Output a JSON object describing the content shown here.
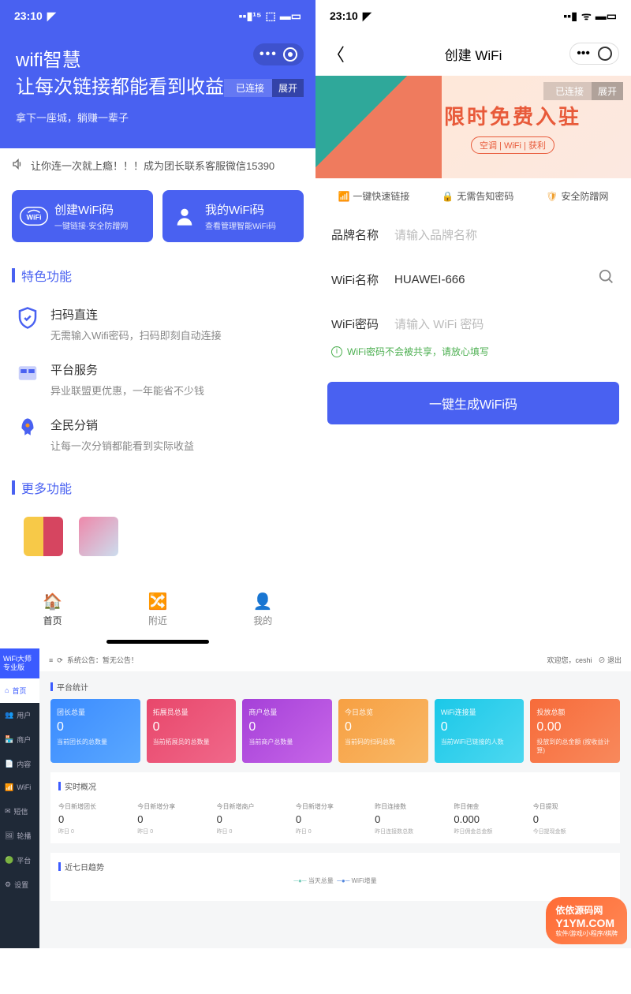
{
  "status_time": "23:10",
  "left": {
    "hero_line1": "wifi智慧",
    "hero_line2": "让每次链接都能看到收益",
    "hero_sub": "拿下一座城，躺赚一辈子",
    "conn_status": "已连接",
    "conn_expand": "展开",
    "marquee": "让你连一次就上瘾！！！成为团长联系客服微信15390",
    "card1_title": "创建WiFi码",
    "card1_sub": "一键链接·安全防蹭网",
    "card2_title": "我的WiFi码",
    "card2_sub": "查看管理智能WiFi码",
    "section1": "特色功能",
    "feat1_name": "扫码直连",
    "feat1_desc": "无需输入Wifi密码，扫码即刻自动连接",
    "feat2_name": "平台服务",
    "feat2_desc": "异业联盟更优惠，一年能省不少钱",
    "feat3_name": "全民分销",
    "feat3_desc": "让每一次分销都能看到实际收益",
    "section2": "更多功能",
    "tab_home": "首页",
    "tab_nearby": "附近",
    "tab_mine": "我的"
  },
  "right": {
    "nav_title": "创建 WiFi",
    "conn_status": "已连接",
    "conn_expand": "展开",
    "banner_title": "限时免费入驻",
    "banner_tags": "空调 | WiFi | 获利",
    "feat1": "一键快速链接",
    "feat2": "无需告知密码",
    "feat3": "安全防蹭网",
    "label_brand": "品牌名称",
    "ph_brand": "请输入品牌名称",
    "label_wifi": "WiFi名称",
    "wifi_value": "HUAWEI-666",
    "label_pwd": "WiFi密码",
    "ph_pwd": "请输入 WiFi 密码",
    "hint": "WiFi密码不会被共享，请放心填写",
    "gen_btn": "一键生成WiFi码"
  },
  "dash": {
    "logo": "WiFi大师专业版",
    "side": [
      "首页",
      "用户",
      "商户",
      "内容",
      "WiFi",
      "短信",
      "轮播",
      "平台",
      "设置"
    ],
    "announce_label": "系统公告：",
    "announce": "暂无公告！",
    "welcome": "欢迎您，ceshi",
    "logout": "退出",
    "sec_stats": "平台统计",
    "stats": [
      {
        "label": "团长总量",
        "value": "0",
        "sub": "当前团长的总数量"
      },
      {
        "label": "拓展员总量",
        "value": "0",
        "sub": "当前拓展员的总数量"
      },
      {
        "label": "商户总量",
        "value": "0",
        "sub": "当前商户总数量"
      },
      {
        "label": "今日总览",
        "value": "0",
        "sub": "当前码的扫码总数"
      },
      {
        "label": "WiFi连接量",
        "value": "0",
        "sub": "当前WiFi已链接的人数"
      },
      {
        "label": "投放总额",
        "value": "0.00",
        "sub": "投放到的总金额 (按收益计算)"
      }
    ],
    "sec_realtime": "实时概况",
    "realtime": [
      {
        "label": "今日新增团长",
        "value": "0",
        "sub": "昨日 0"
      },
      {
        "label": "今日新增分享",
        "value": "0",
        "sub": "昨日 0"
      },
      {
        "label": "今日新增商户",
        "value": "0",
        "sub": "昨日 0"
      },
      {
        "label": "今日新增分享",
        "value": "0",
        "sub": "昨日 0"
      },
      {
        "label": "昨日连接数",
        "value": "0",
        "sub": "昨日连接数总数"
      },
      {
        "label": "昨日佣金",
        "value": "0.000",
        "sub": "昨日佣金总金额"
      },
      {
        "label": "今日提现",
        "value": "0",
        "sub": "今日提现金额"
      }
    ],
    "sec_trend": "近七日趋势",
    "legend1": "当天总量",
    "legend2": "WiFi增量"
  },
  "watermark": {
    "name": "依依源码网",
    "site": "Y1YM.COM",
    "sub": "软件/游戏/小程序/棋牌"
  }
}
